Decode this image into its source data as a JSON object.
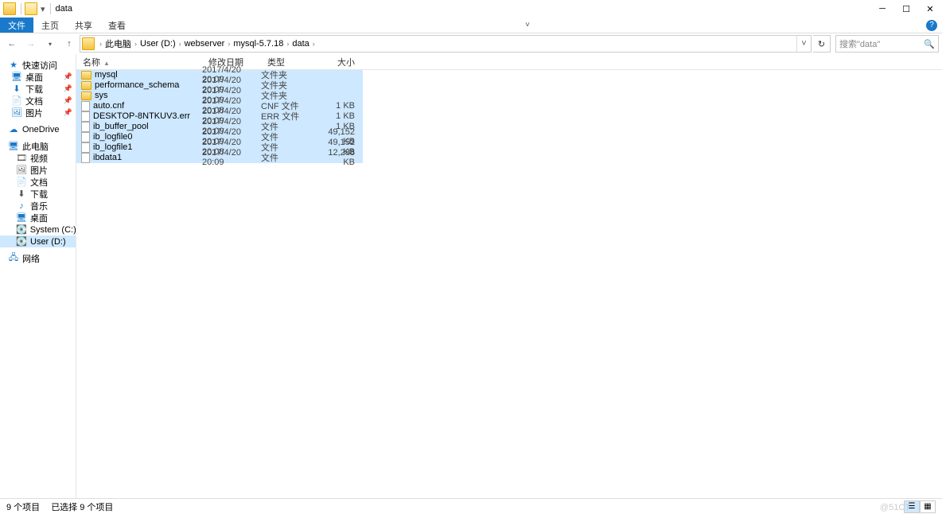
{
  "window": {
    "title": "data"
  },
  "ribbon": {
    "tabs": [
      "文件",
      "主页",
      "共享",
      "查看"
    ],
    "active_index": 0
  },
  "nav": {
    "breadcrumb": [
      "此电脑",
      "User (D:)",
      "webserver",
      "mysql-5.7.18",
      "data"
    ],
    "search_placeholder": "搜索\"data\""
  },
  "tree": {
    "quick_access": {
      "label": "快速访问",
      "items": [
        {
          "label": "桌面",
          "icon": "🖥",
          "color": "#1979ca",
          "pinned": true
        },
        {
          "label": "下载",
          "icon": "⬇",
          "color": "#1979ca",
          "pinned": true
        },
        {
          "label": "文档",
          "icon": "📄",
          "color": "#1979ca",
          "pinned": true
        },
        {
          "label": "图片",
          "icon": "🖼",
          "color": "#1979ca",
          "pinned": true
        }
      ]
    },
    "onedrive": {
      "label": "OneDrive",
      "icon": "☁",
      "color": "#1979ca"
    },
    "this_pc": {
      "label": "此电脑",
      "icon": "🖥",
      "color": "#1979ca",
      "items": [
        {
          "label": "视频",
          "icon": "🎞"
        },
        {
          "label": "图片",
          "icon": "🖼"
        },
        {
          "label": "文档",
          "icon": "📄"
        },
        {
          "label": "下载",
          "icon": "⬇"
        },
        {
          "label": "音乐",
          "icon": "♪",
          "color": "#1979ca"
        },
        {
          "label": "桌面",
          "icon": "🖥",
          "color": "#1979ca"
        },
        {
          "label": "System (C:)",
          "icon": "💽"
        },
        {
          "label": "User (D:)",
          "icon": "💽",
          "selected": true
        }
      ]
    },
    "network": {
      "label": "网络",
      "icon": "🖧",
      "color": "#1979ca"
    }
  },
  "columns": {
    "name": "名称",
    "date": "修改日期",
    "type": "类型",
    "size": "大小"
  },
  "files": [
    {
      "name": "mysql",
      "date": "2017/4/20 20:09",
      "type": "文件夹",
      "size": "",
      "kind": "folder"
    },
    {
      "name": "performance_schema",
      "date": "2017/4/20 20:09",
      "type": "文件夹",
      "size": "",
      "kind": "folder"
    },
    {
      "name": "sys",
      "date": "2017/4/20 20:09",
      "type": "文件夹",
      "size": "",
      "kind": "folder"
    },
    {
      "name": "auto.cnf",
      "date": "2017/4/20 20:08",
      "type": "CNF 文件",
      "size": "1 KB",
      "kind": "file"
    },
    {
      "name": "DESKTOP-8NTKUV3.err",
      "date": "2017/4/20 20:09",
      "type": "ERR 文件",
      "size": "1 KB",
      "kind": "file"
    },
    {
      "name": "ib_buffer_pool",
      "date": "2017/4/20 20:09",
      "type": "文件",
      "size": "1 KB",
      "kind": "file"
    },
    {
      "name": "ib_logfile0",
      "date": "2017/4/20 20:09",
      "type": "文件",
      "size": "49,152 KB",
      "kind": "file"
    },
    {
      "name": "ib_logfile1",
      "date": "2017/4/20 20:08",
      "type": "文件",
      "size": "49,152 KB",
      "kind": "file"
    },
    {
      "name": "ibdata1",
      "date": "2017/4/20 20:09",
      "type": "文件",
      "size": "12,288 KB",
      "kind": "file"
    }
  ],
  "status": {
    "count": "9 个项目",
    "selected": "已选择 9 个项目"
  },
  "watermark": "@51CT"
}
